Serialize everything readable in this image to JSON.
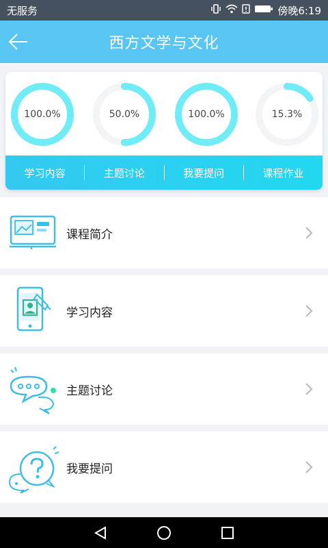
{
  "status_bar": {
    "carrier": "无服务",
    "time": "傍晚6:19",
    "icons": [
      "vibrate-icon",
      "wifi-icon",
      "sim-alert-icon",
      "battery-icon"
    ]
  },
  "header": {
    "title": "西方文学与文化",
    "back_icon": "arrow-left-icon"
  },
  "progress": {
    "rings": [
      {
        "label": "100.0%",
        "value": 1.0
      },
      {
        "label": "50.0%",
        "value": 0.5
      },
      {
        "label": "100.0%",
        "value": 1.0
      },
      {
        "label": "15.3%",
        "value": 0.153
      }
    ],
    "tabs": [
      "学习内容",
      "主题讨论",
      "我要提问",
      "课程作业"
    ]
  },
  "list": {
    "items": [
      {
        "label": "课程简介",
        "icon": "presentation-board-icon"
      },
      {
        "label": "学习内容",
        "icon": "mobile-learning-icon"
      },
      {
        "label": "主题讨论",
        "icon": "chat-bubbles-icon"
      },
      {
        "label": "我要提问",
        "icon": "question-bubble-icon"
      }
    ]
  },
  "colors": {
    "header": "#58c5f2",
    "ring": "#6fecf6",
    "ring_track": "#f3f4f6",
    "tab_strip": "#2ad2f1",
    "icon_stroke": "#3bbde8"
  },
  "nav": [
    "back-triangle-icon",
    "home-circle-icon",
    "recents-square-icon"
  ]
}
